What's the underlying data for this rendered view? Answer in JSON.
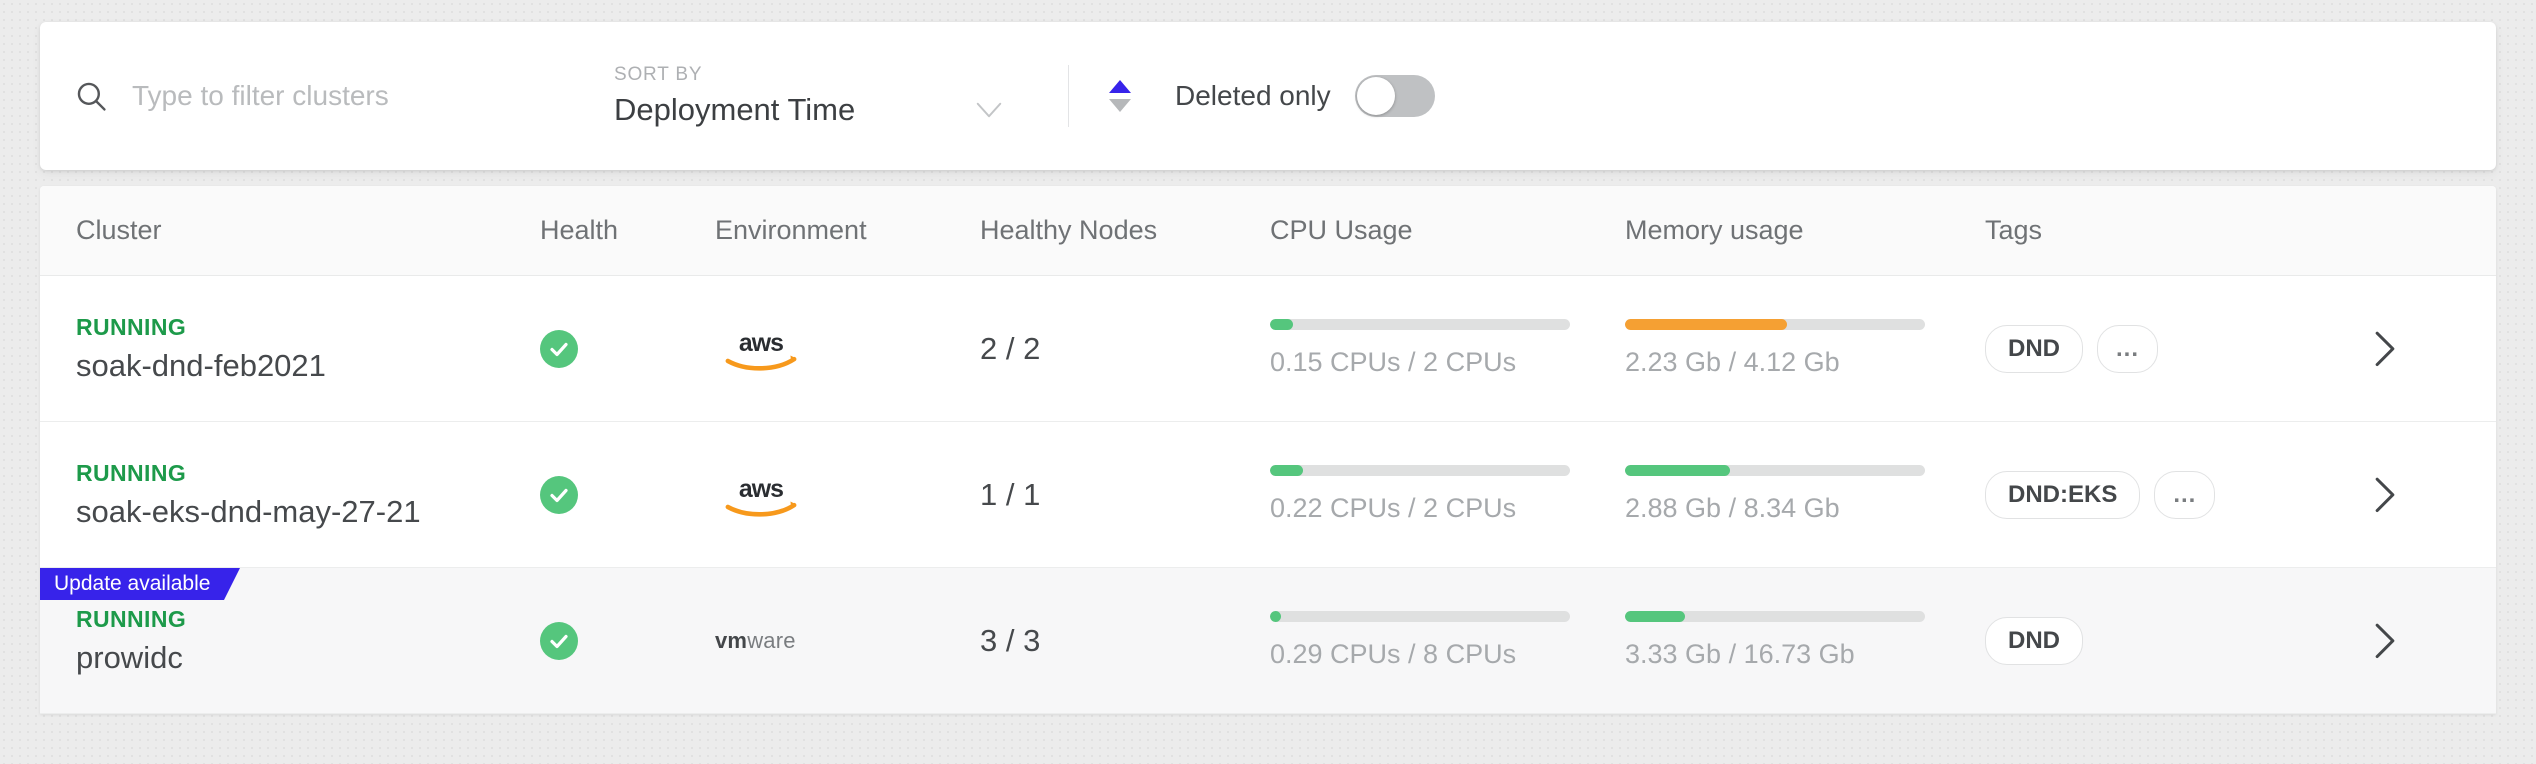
{
  "toolbar": {
    "search": {
      "icon": "search-icon",
      "placeholder": "Type to filter clusters",
      "value": ""
    },
    "sort": {
      "label": "SORT BY",
      "value": "Deployment Time",
      "chevron_icon": "chevron-down-icon",
      "direction_icon_up": "triangle-up-icon",
      "direction_icon_down": "triangle-down-icon",
      "active_direction": "asc",
      "active_color": "#3723ea",
      "inactive_color": "#b6b8ba"
    },
    "deleted_only": {
      "label": "Deleted only",
      "state": "off"
    }
  },
  "table": {
    "headers": [
      "Cluster",
      "Health",
      "Environment",
      "Healthy Nodes",
      "CPU Usage",
      "Memory usage",
      "Tags"
    ],
    "rows": [
      {
        "status": "RUNNING",
        "name": "soak-dnd-feb2021",
        "health_icon": "check-circle-icon",
        "environment": "aws",
        "environment_logo": "aws-logo",
        "healthy_nodes": "2 / 2",
        "cpu": {
          "text": "0.15 CPUs / 2 CPUs",
          "percent": 7.5,
          "color": "#55c67d"
        },
        "memory": {
          "text": "2.23 Gb / 4.12 Gb",
          "percent": 54,
          "color": "#f5a033"
        },
        "tags": [
          "DND",
          "..."
        ],
        "badge": null,
        "chevron_icon": "chevron-right-icon"
      },
      {
        "status": "RUNNING",
        "name": "soak-eks-dnd-may-27-21",
        "health_icon": "check-circle-icon",
        "environment": "aws",
        "environment_logo": "aws-logo",
        "healthy_nodes": "1 / 1",
        "cpu": {
          "text": "0.22 CPUs / 2 CPUs",
          "percent": 11,
          "color": "#55c67d"
        },
        "memory": {
          "text": "2.88 Gb / 8.34 Gb",
          "percent": 35,
          "color": "#55c67d"
        },
        "tags": [
          "DND:EKS",
          "..."
        ],
        "badge": null,
        "chevron_icon": "chevron-right-icon"
      },
      {
        "status": "RUNNING",
        "name": "prowidc",
        "health_icon": "check-circle-icon",
        "environment": "vmware",
        "environment_logo": "vmware-logo",
        "healthy_nodes": "3 / 3",
        "cpu": {
          "text": "0.29 CPUs / 8 CPUs",
          "percent": 3.6,
          "color": "#55c67d"
        },
        "memory": {
          "text": "3.33 Gb / 16.73 Gb",
          "percent": 20,
          "color": "#55c67d"
        },
        "tags": [
          "DND"
        ],
        "badge": "Update available",
        "chevron_icon": "chevron-right-icon"
      }
    ]
  },
  "colors": {
    "status_running": "#1d9a4a",
    "health_ok": "#55c67d",
    "badge": "#3723ea",
    "bar_green": "#55c67d",
    "bar_orange": "#f5a033",
    "bar_track": "#dfe0e0"
  }
}
